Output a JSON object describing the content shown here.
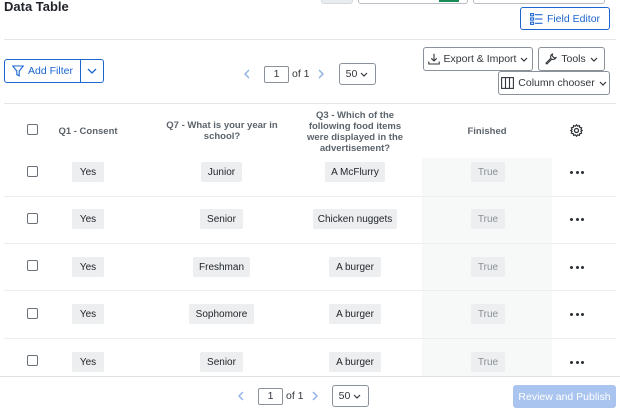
{
  "page": {
    "title": "Data Table"
  },
  "toolbar": {
    "field_editor_label": "Field Editor",
    "add_filter_label": "Add Filter",
    "export_import_label": "Export & Import",
    "tools_label": "Tools",
    "column_chooser_label": "Column chooser"
  },
  "pagination_top": {
    "page": "1",
    "of_label": "of 1",
    "page_size": "50"
  },
  "pagination_bottom": {
    "page": "1",
    "of_label": "of 1",
    "page_size": "50"
  },
  "table": {
    "columns": {
      "q1": "Q1 - Consent",
      "q7": "Q7 - What is your year in school?",
      "q3": "Q3 - Which of the following food items were displayed in the advertisement?",
      "finished": "Finished"
    },
    "rows": [
      {
        "q1": "Yes",
        "q7": "Junior",
        "q3": "A McFlurry",
        "finished": "True"
      },
      {
        "q1": "Yes",
        "q7": "Senior",
        "q3": "Chicken nuggets",
        "finished": "True"
      },
      {
        "q1": "Yes",
        "q7": "Freshman",
        "q3": "A burger",
        "finished": "True"
      },
      {
        "q1": "Yes",
        "q7": "Sophomore",
        "q3": "A burger",
        "finished": "True"
      },
      {
        "q1": "Yes",
        "q7": "Senior",
        "q3": "A burger",
        "finished": "True"
      }
    ]
  },
  "footer": {
    "review_publish_label": "Review and Publish"
  },
  "icons": {
    "field_editor": "field-editor-icon",
    "filter": "filter-icon",
    "export": "download-icon",
    "tools": "wrench-icon",
    "column_chooser": "columns-icon",
    "settings": "gear-icon",
    "row_actions": "more-horizontal-icon"
  },
  "colors": {
    "accent": "#1b66d1",
    "publish_disabled": "#a9c4ee",
    "finished_column_bg": "#f7f8f8"
  }
}
